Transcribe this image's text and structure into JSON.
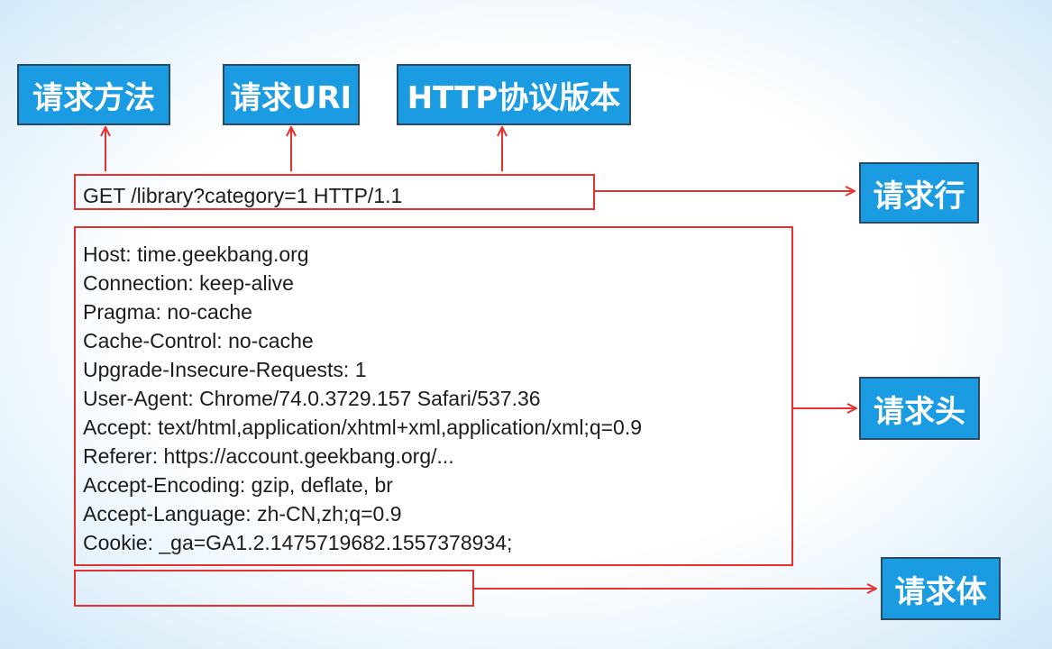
{
  "labels": {
    "method": "请求方法",
    "uri": "请求URI",
    "version": "HTTP协议版本",
    "request_line": "请求行",
    "request_header": "请求头",
    "request_body": "请求体"
  },
  "request_line": "GET /library?category=1 HTTP/1.1",
  "headers": [
    "Host: time.geekbang.org",
    "Connection: keep-alive",
    "Pragma: no-cache",
    "Cache-Control: no-cache",
    "Upgrade-Insecure-Requests: 1",
    "User-Agent: Chrome/74.0.3729.157 Safari/537.36",
    "Accept: text/html,application/xhtml+xml,application/xml;q=0.9",
    "Referer: https://account.geekbang.org/...",
    "Accept-Encoding: gzip, deflate, br",
    "Accept-Language: zh-CN,zh;q=0.9",
    "Cookie: _ga=GA1.2.1475719682.1557378934;"
  ],
  "colors": {
    "label_fill": "#1a9be2",
    "label_border": "#2a4a66",
    "arrow": "#e8312f"
  }
}
